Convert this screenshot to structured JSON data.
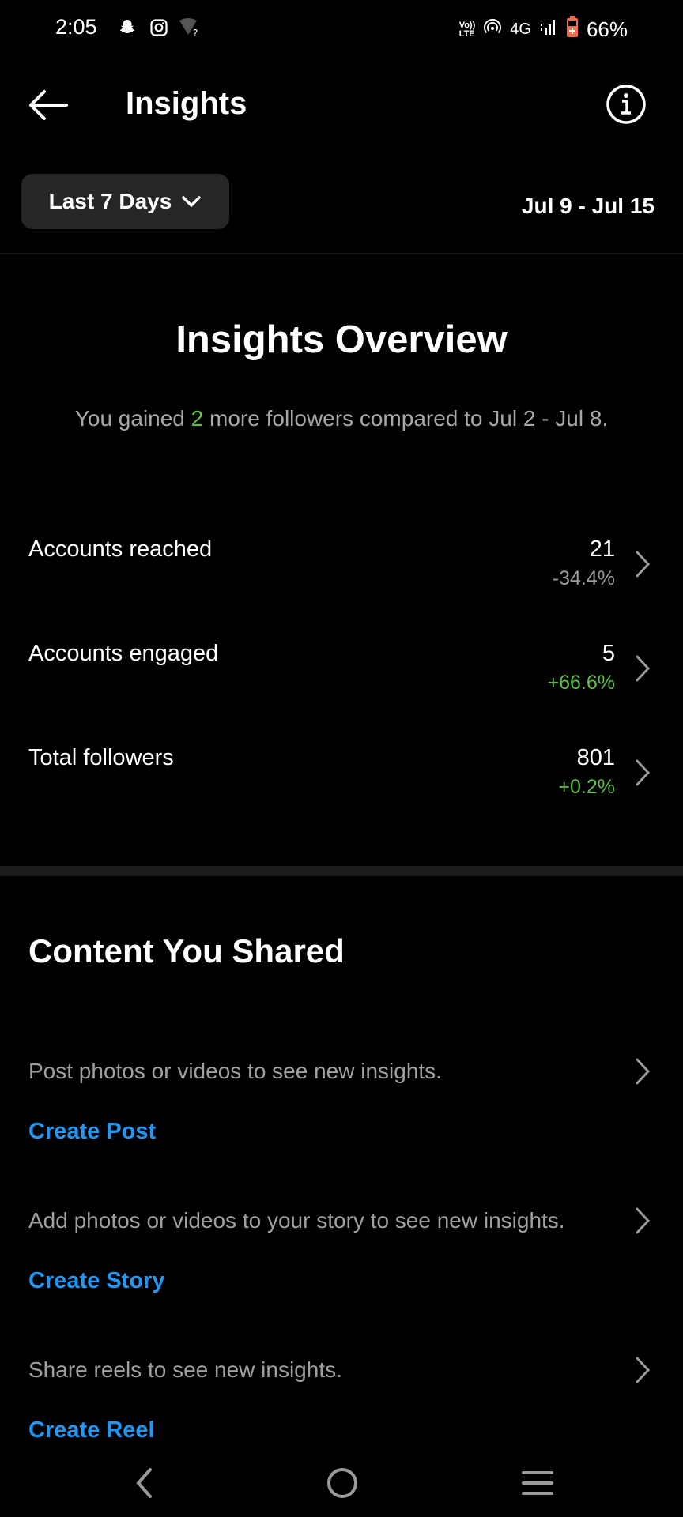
{
  "status_bar": {
    "time": "2:05",
    "battery": "66%",
    "network": "4G",
    "volte": "Vo LTE",
    "left_icons": [
      "snapchat-icon",
      "instagram-icon",
      "wifi-unknown-icon"
    ],
    "right_icons": [
      "volte-icon",
      "hotspot-icon",
      "signal-icon",
      "battery-icon"
    ],
    "battery_color": "#ef6c4a"
  },
  "header": {
    "title": "Insights",
    "back_icon": "arrow-left-icon",
    "info_icon": "info-icon"
  },
  "filter": {
    "range_label": "Last 7 Days",
    "date_range": "Jul 9 - Jul 15"
  },
  "overview": {
    "title": "Insights Overview",
    "summary_prefix": "You gained ",
    "summary_count": "2",
    "summary_suffix": " more followers compared to Jul 2 - Jul 8."
  },
  "metrics": [
    {
      "label": "Accounts reached",
      "value": "21",
      "change": "-34.4%",
      "trend": "negative"
    },
    {
      "label": "Accounts engaged",
      "value": "5",
      "change": "+66.6%",
      "trend": "positive"
    },
    {
      "label": "Total followers",
      "value": "801",
      "change": "+0.2%",
      "trend": "positive"
    }
  ],
  "content_shared": {
    "title": "Content You Shared",
    "items": [
      {
        "description": "Post photos or videos to see new insights.",
        "link": "Create Post"
      },
      {
        "description": "Add photos or videos to your story to see new insights.",
        "link": "Create Story"
      },
      {
        "description": "Share reels to see new insights.",
        "link": "Create Reel"
      }
    ]
  },
  "colors": {
    "background": "#000000",
    "positive": "#5fc247",
    "link": "#2196f3",
    "muted": "#a8a8a8",
    "dropdown_bg": "#262626"
  },
  "nav_bar": {
    "buttons": [
      "back-icon",
      "home-icon",
      "recents-icon"
    ]
  }
}
